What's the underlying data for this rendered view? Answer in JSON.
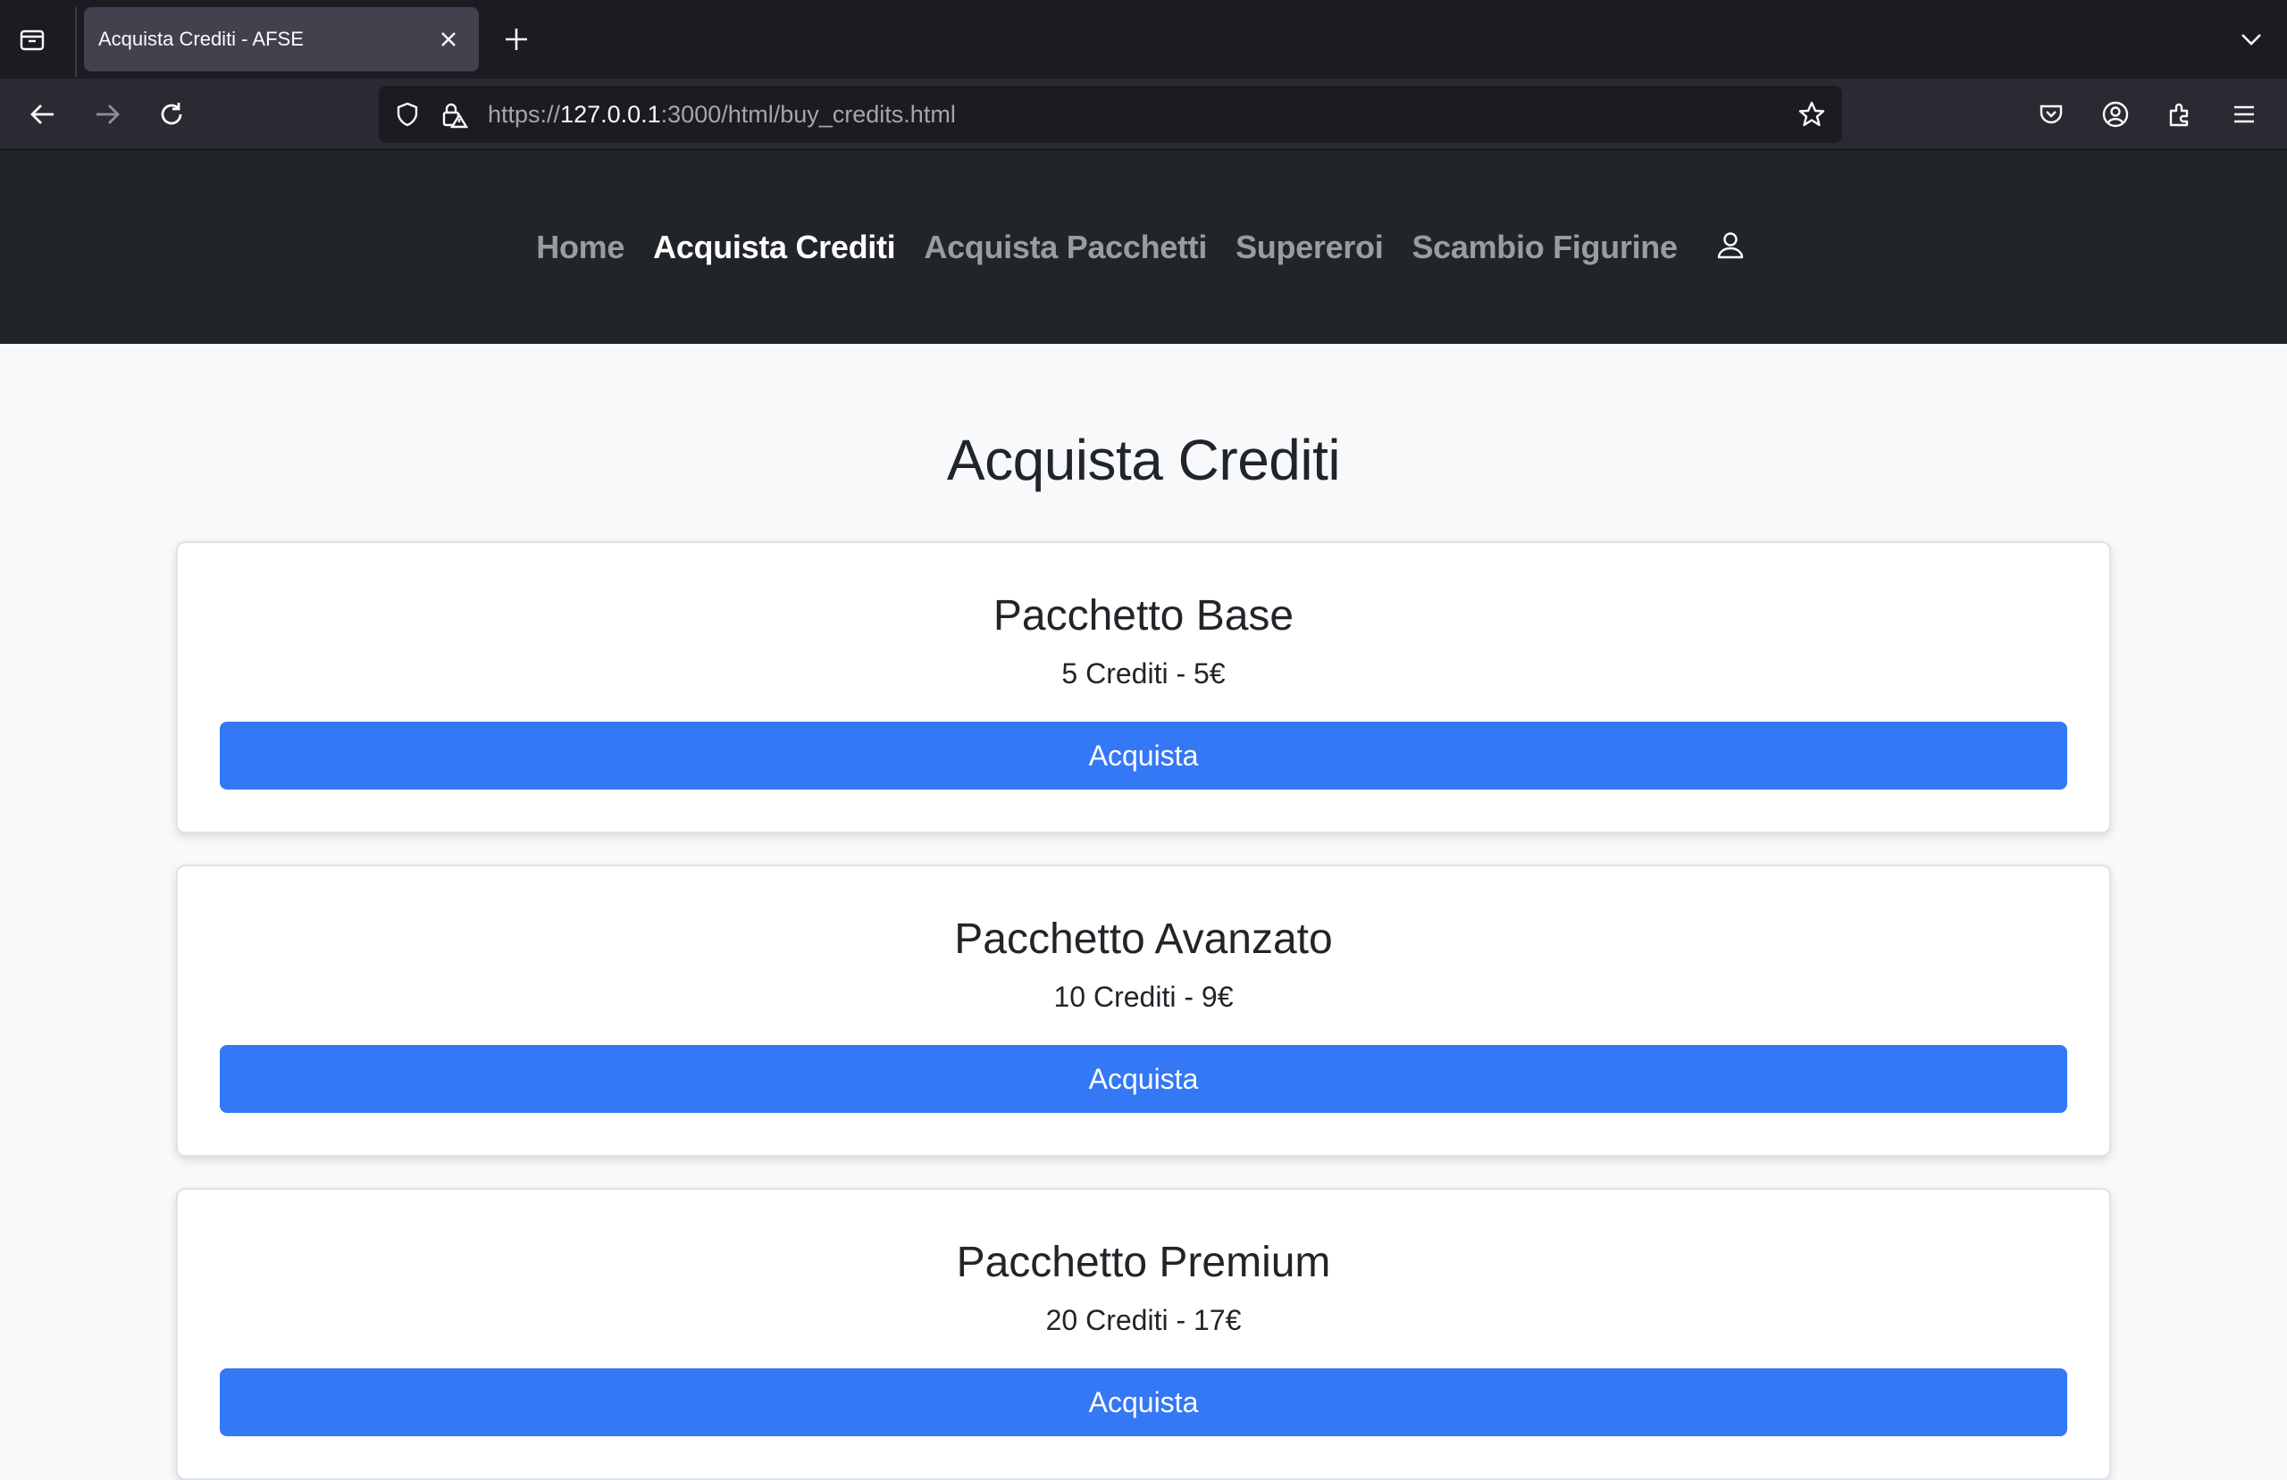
{
  "browser": {
    "tab_title": "Acquista Crediti - AFSE",
    "url_scheme": "https://",
    "url_host": "127.0.0.1",
    "url_rest": ":3000/html/buy_credits.html"
  },
  "nav": {
    "items": [
      {
        "label": "Home",
        "active": false
      },
      {
        "label": "Acquista Crediti",
        "active": true
      },
      {
        "label": "Acquista Pacchetti",
        "active": false
      },
      {
        "label": "Supereroi",
        "active": false
      },
      {
        "label": "Scambio Figurine",
        "active": false
      }
    ],
    "user_icon": "person-icon"
  },
  "page": {
    "title": "Acquista Crediti"
  },
  "packages": [
    {
      "name": "Pacchetto Base",
      "details": "5 Crediti - 5€",
      "button": "Acquista"
    },
    {
      "name": "Pacchetto Avanzato",
      "details": "10 Crediti - 9€",
      "button": "Acquista"
    },
    {
      "name": "Pacchetto Premium",
      "details": "20 Crediti - 17€",
      "button": "Acquista"
    }
  ],
  "colors": {
    "navbar_bg": "#212529",
    "button_bg": "#3478f6",
    "page_bg": "#f8f9fa"
  }
}
